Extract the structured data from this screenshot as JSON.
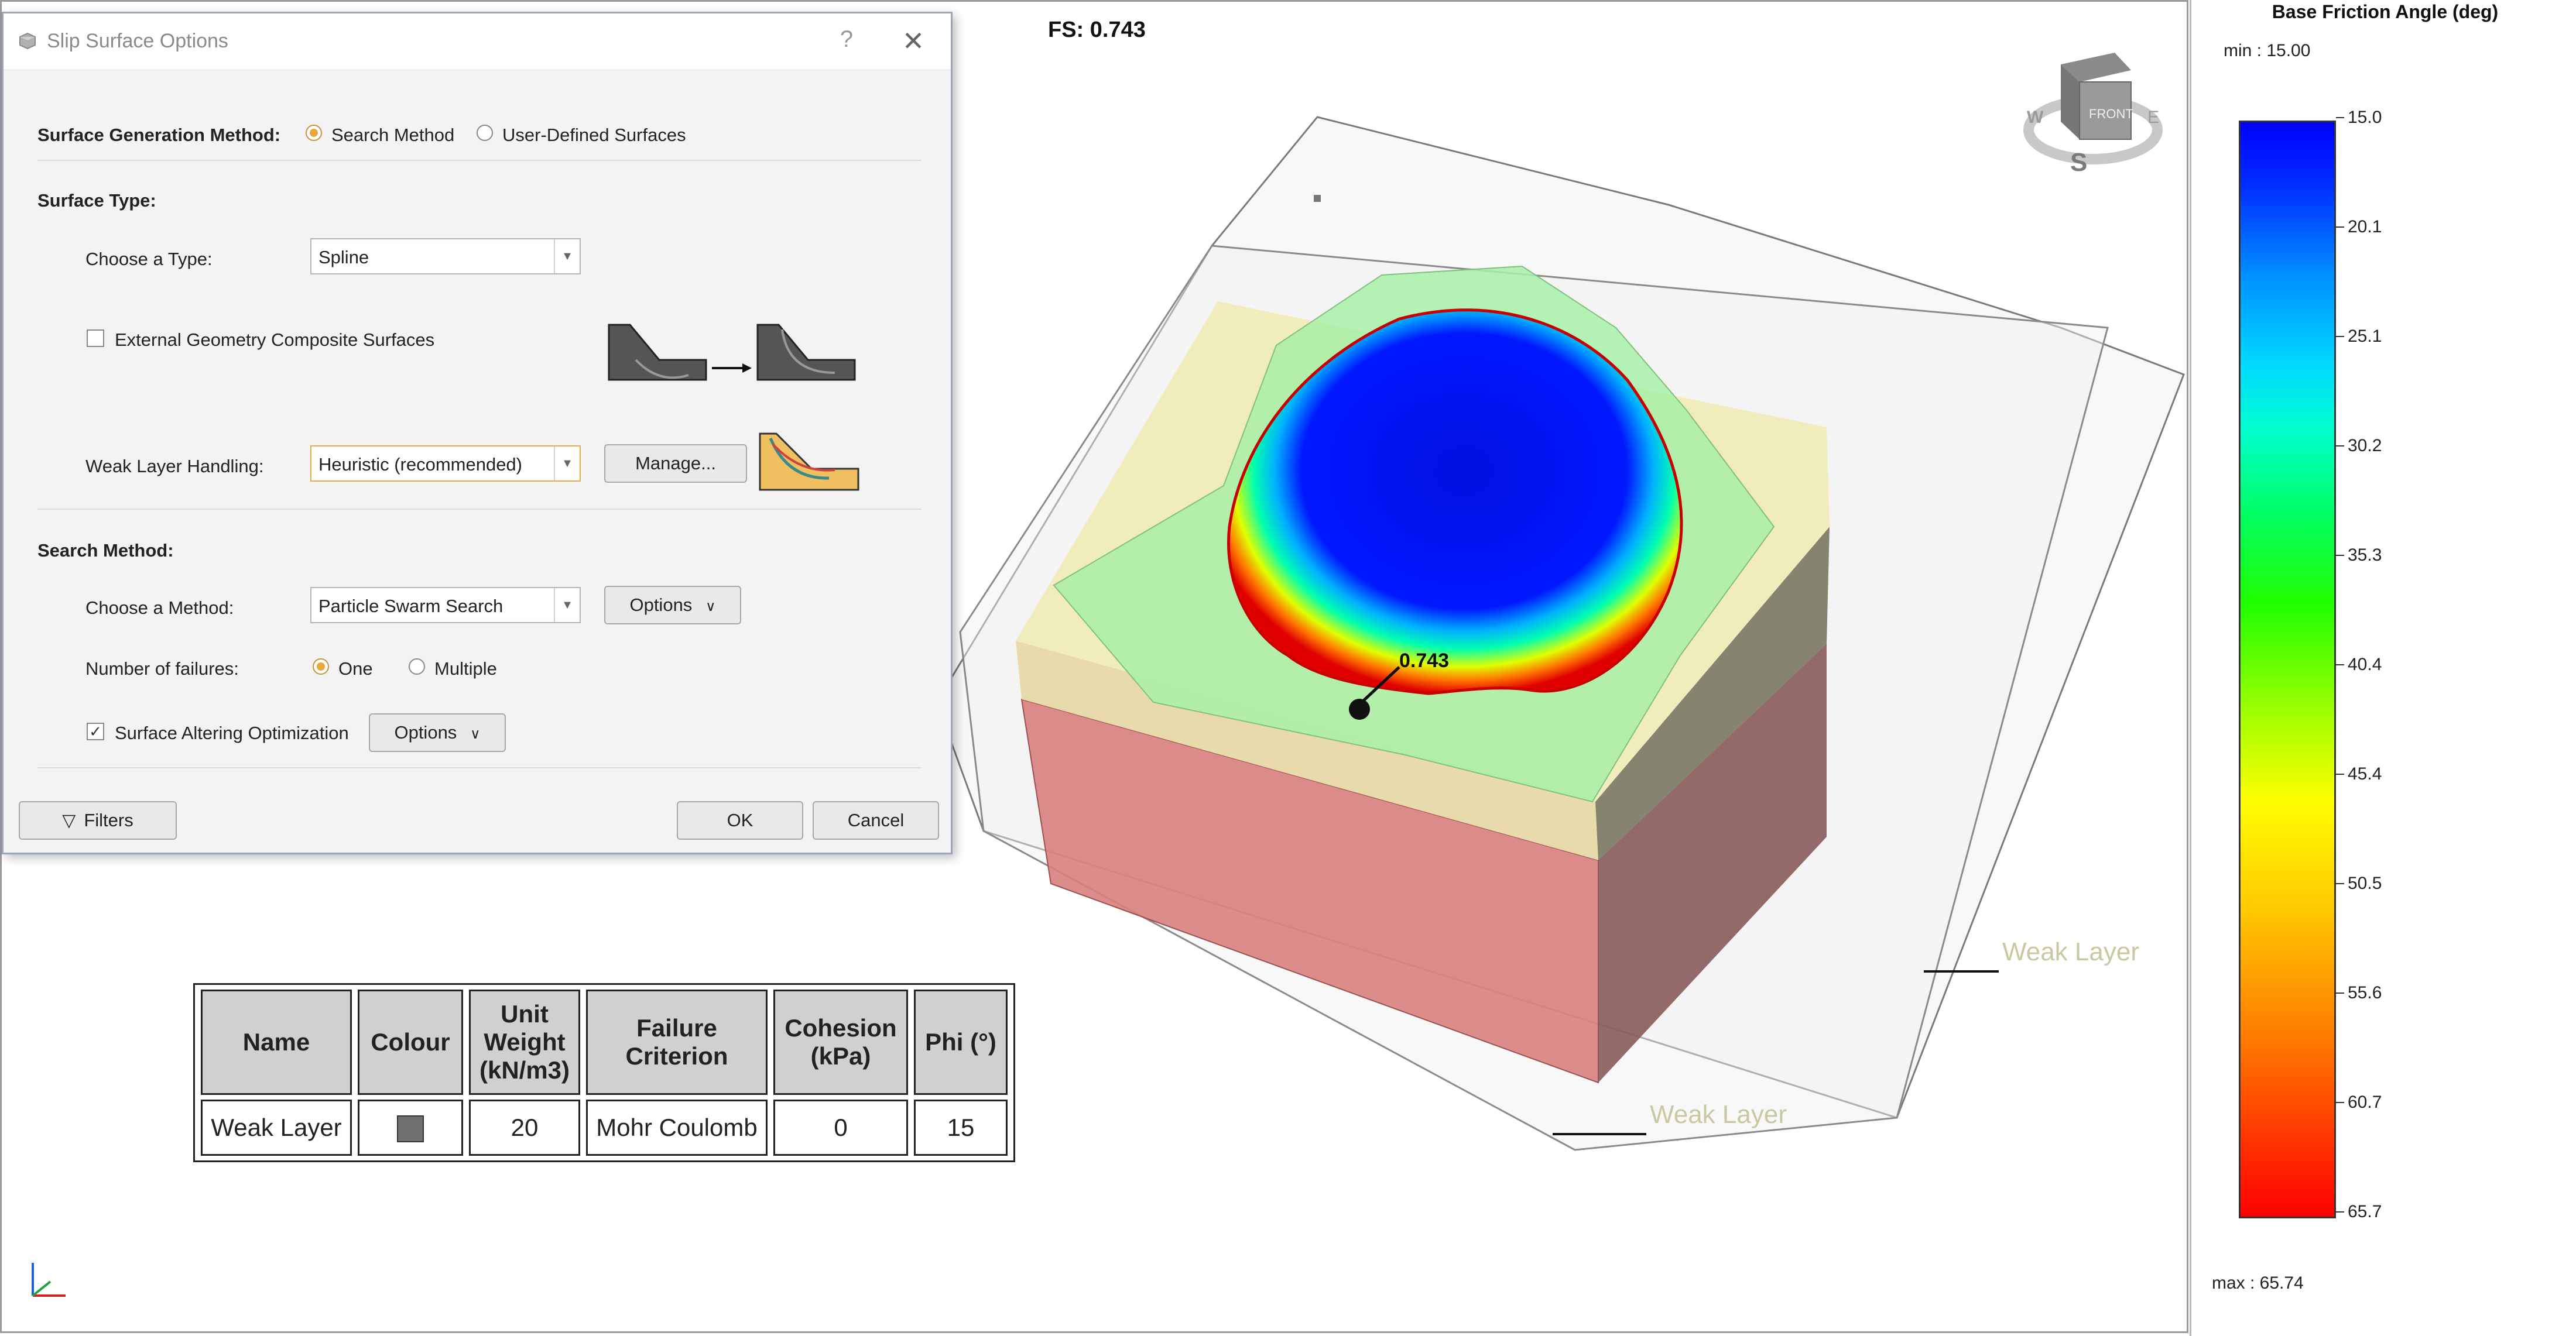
{
  "viewport": {
    "fs_label": "FS: 0.743",
    "surface_fs_label": "0.743",
    "weak_layer_label_upper": "Weak Layer",
    "weak_layer_label_lower": "Weak Layer",
    "compass": {
      "front": "FRONT",
      "south": "S",
      "west": "W",
      "east": "E"
    }
  },
  "dialog": {
    "title": "Slip Surface Options",
    "help": "?",
    "close": "✕",
    "surface_generation": {
      "label": "Surface Generation Method:",
      "option_search": "Search Method",
      "option_user": "User-Defined Surfaces",
      "selected": "Search Method"
    },
    "surface_type": {
      "heading": "Surface Type:",
      "choose_label": "Choose a Type:",
      "choose_value": "Spline",
      "external_label": "External Geometry Composite Surfaces",
      "external_checked": false,
      "weak_label": "Weak Layer Handling:",
      "weak_value": "Heuristic (recommended)",
      "manage_button": "Manage..."
    },
    "search_method": {
      "heading": "Search Method:",
      "choose_label": "Choose a Method:",
      "choose_value": "Particle Swarm Search",
      "options_button": "Options",
      "failures_label": "Number of failures:",
      "failures_one": "One",
      "failures_multiple": "Multiple",
      "failures_selected": "One",
      "sao_label": "Surface Altering Optimization",
      "sao_checked": true,
      "sao_options_button": "Options"
    },
    "footer": {
      "filters_button": "Filters",
      "ok_button": "OK",
      "cancel_button": "Cancel"
    }
  },
  "material_table": {
    "headers": [
      "Name",
      "Colour",
      "Unit Weight (kN/m3)",
      "Failure Criterion",
      "Cohesion (kPa)",
      "Phi (°)"
    ],
    "header_lines": [
      [
        "Name"
      ],
      [
        "Colour"
      ],
      [
        "Unit",
        "Weight",
        "(kN/m3)"
      ],
      [
        "Failure",
        "Criterion"
      ],
      [
        "Cohesion",
        "(kPa)"
      ],
      [
        "Phi (°)"
      ]
    ],
    "row": {
      "name": "Weak Layer",
      "colour": "#707070",
      "unit_weight": "20",
      "failure_criterion": "Mohr Coulomb",
      "cohesion": "0",
      "phi": "15"
    }
  },
  "legend": {
    "title": "Base Friction Angle (deg)",
    "min_label": "min :   15.00",
    "max_label": "max :  65.74",
    "ticks": [
      "15.0",
      "20.1",
      "25.1",
      "30.2",
      "35.3",
      "40.4",
      "45.4",
      "50.5",
      "55.6",
      "60.7",
      "65.7"
    ]
  }
}
